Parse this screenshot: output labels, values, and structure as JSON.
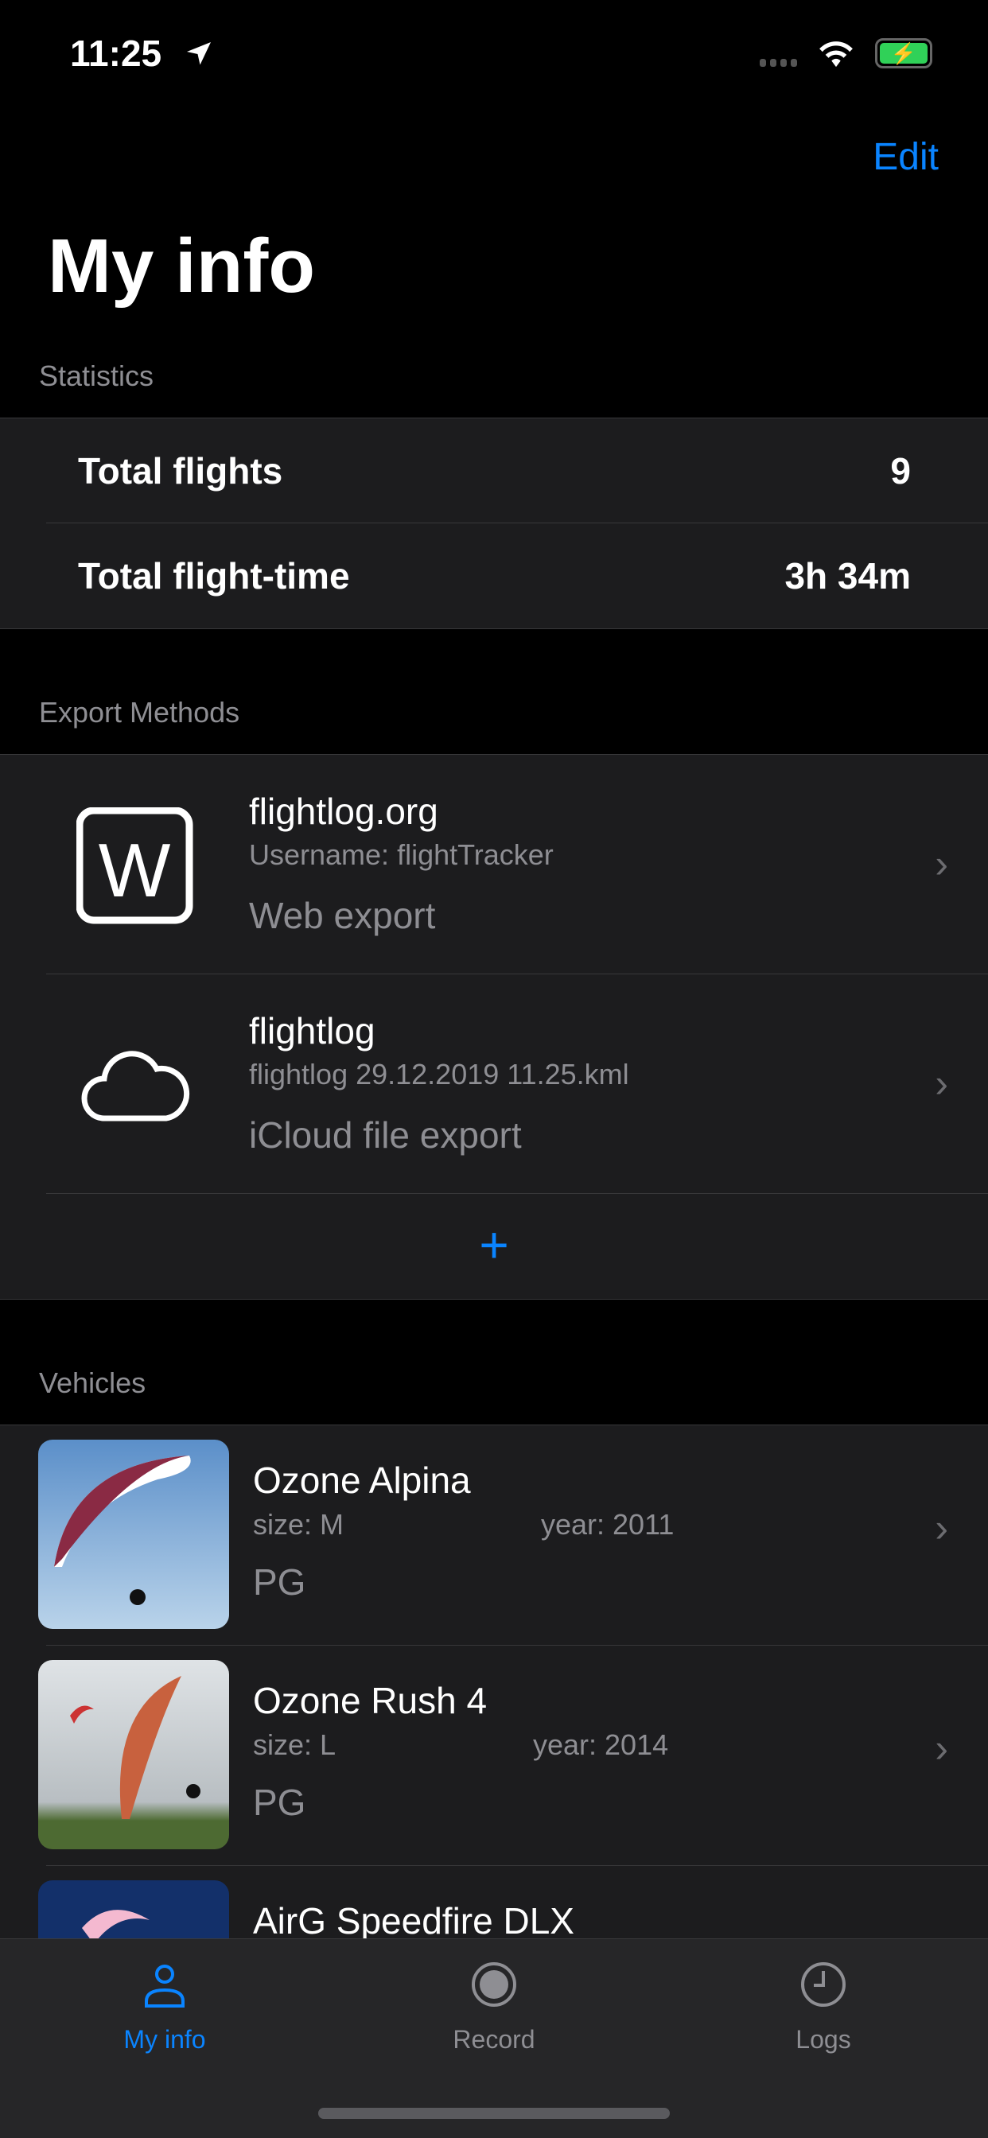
{
  "status": {
    "time": "11:25"
  },
  "nav": {
    "edit_label": "Edit",
    "title": "My info"
  },
  "statistics": {
    "header": "Statistics",
    "rows": [
      {
        "label": "Total flights",
        "value": "9"
      },
      {
        "label": "Total flight-time",
        "value": "3h 34m"
      }
    ]
  },
  "export": {
    "header": "Export Methods",
    "items": [
      {
        "icon": "w-box-icon",
        "title": "flightlog.org",
        "subtitle": "Username: flightTracker",
        "type": "Web export"
      },
      {
        "icon": "cloud-icon",
        "title": "flightlog",
        "subtitle": "flightlog 29.12.2019 11.25.kml",
        "type": "iCloud file export"
      }
    ],
    "add_label": "+"
  },
  "vehicles": {
    "header": "Vehicles",
    "items": [
      {
        "name": "Ozone Alpina",
        "size": "size: M",
        "year": "year: 2011",
        "type": "PG"
      },
      {
        "name": "Ozone Rush 4",
        "size": "size: L",
        "year": "year: 2014",
        "type": "PG"
      },
      {
        "name": "AirG Speedfire DLX"
      }
    ]
  },
  "tabs": [
    {
      "label": "My info",
      "active": true
    },
    {
      "label": "Record"
    },
    {
      "label": "Logs"
    }
  ],
  "colors": {
    "accent": "#0a84ff",
    "battery": "#30d158"
  }
}
